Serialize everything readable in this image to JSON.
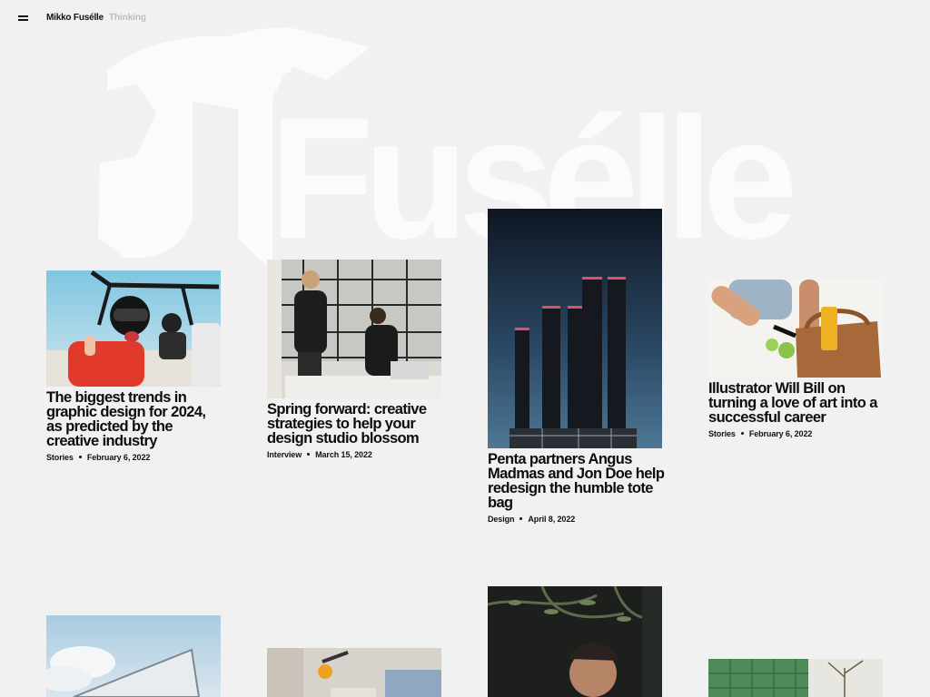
{
  "header": {
    "menu_icon": "hamburger-icon",
    "site_name": "Mikko Fusélle",
    "section": "Thinking"
  },
  "hero": {
    "wordmark": "Fusélle"
  },
  "articles": [
    {
      "title": "The biggest trends in graphic design for 2024, as predicted by the creative industry",
      "category": "Stories",
      "date": "February 6, 2022"
    },
    {
      "title": "Spring forward: creative strategies to help your design studio blossom",
      "category": "Interview",
      "date": "March 15, 2022"
    },
    {
      "title": "Penta partners Angus Madmas and Jon Doe help redesign the humble tote bag",
      "category": "Design",
      "date": "April 8, 2022"
    },
    {
      "title": "Illustrator Will Bill on turning a love of art into a successful career",
      "category": "Stories",
      "date": "February 6, 2022"
    }
  ],
  "colors": {
    "background": "#f1f1f1",
    "text": "#0d0d0d",
    "muted": "#bdbdbd",
    "wordmark": "#fbfbfb"
  }
}
